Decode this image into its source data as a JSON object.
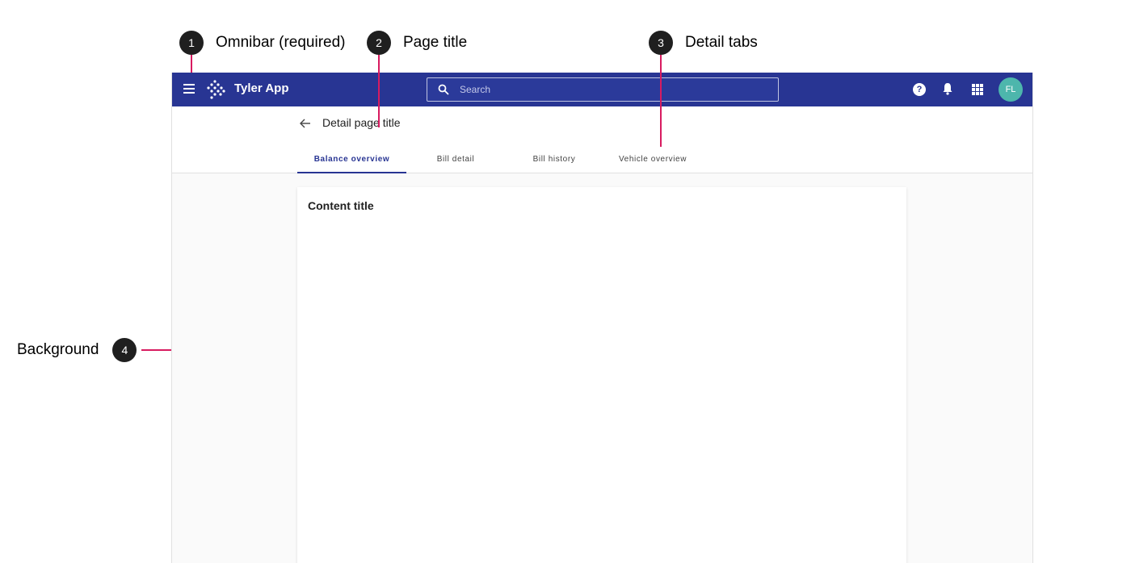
{
  "annotations": [
    {
      "num": "1",
      "label": "Omnibar (required)"
    },
    {
      "num": "2",
      "label": "Page title"
    },
    {
      "num": "3",
      "label": "Detail tabs"
    },
    {
      "num": "4",
      "label": "Background"
    }
  ],
  "omnibar": {
    "app_name": "Tyler App",
    "search_placeholder": "Search",
    "help_glyph": "?",
    "avatar_initials": "FL",
    "icons": [
      "menu-icon",
      "logo-icon",
      "search-icon",
      "help-icon",
      "bell-icon",
      "apps-icon"
    ],
    "color": "#283593"
  },
  "header": {
    "page_title": "Detail page title",
    "tabs": [
      {
        "label": "Balance overview",
        "active": true
      },
      {
        "label": "Bill detail",
        "active": false
      },
      {
        "label": "Bill history",
        "active": false
      },
      {
        "label": "Vehicle overview",
        "active": false
      }
    ]
  },
  "content": {
    "title": "Content title"
  },
  "colors": {
    "annotation_line": "#d81b60",
    "avatar": "#4db6ac",
    "background": "#fafafa"
  }
}
